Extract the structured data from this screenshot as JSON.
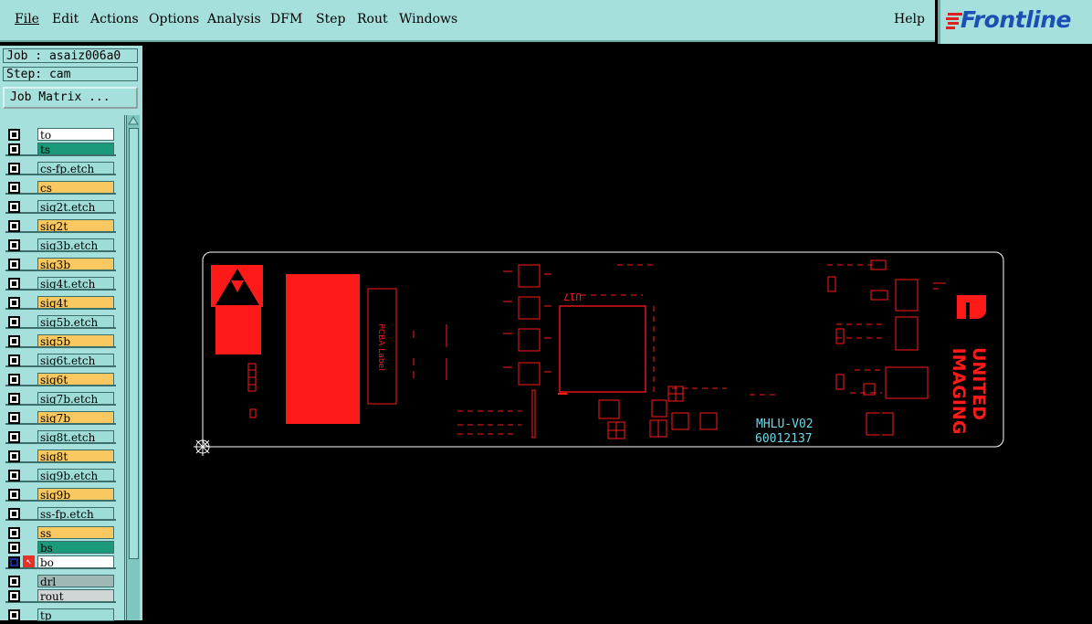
{
  "menu": {
    "items": [
      "File",
      "Edit",
      "Actions",
      "Options",
      "Analysis",
      "DFM",
      "Step",
      "Rout",
      "Windows"
    ],
    "help": "Help"
  },
  "logo": {
    "text": "Frontline",
    "icon": "frontline-logo-icon"
  },
  "sidebar": {
    "job": "Job : asaiz006a0",
    "step": "Step: cam",
    "job_matrix": "Job Matrix ..."
  },
  "layers": [
    {
      "name": "to",
      "color": "white"
    },
    {
      "name": "ts",
      "color": "green"
    },
    {
      "name": "cs-fp.etch",
      "color": "cyan"
    },
    {
      "name": "cs",
      "color": "orange"
    },
    {
      "name": "sig2t.etch",
      "color": "cyan"
    },
    {
      "name": "sig2t",
      "color": "orange"
    },
    {
      "name": "sig3b.etch",
      "color": "cyan"
    },
    {
      "name": "sig3b",
      "color": "orange"
    },
    {
      "name": "sig4t.etch",
      "color": "cyan"
    },
    {
      "name": "sig4t",
      "color": "orange"
    },
    {
      "name": "sig5b.etch",
      "color": "cyan"
    },
    {
      "name": "sig5b",
      "color": "orange"
    },
    {
      "name": "sig6t.etch",
      "color": "cyan"
    },
    {
      "name": "sig6t",
      "color": "orange"
    },
    {
      "name": "sig7b.etch",
      "color": "cyan"
    },
    {
      "name": "sig7b",
      "color": "orange"
    },
    {
      "name": "sig8t.etch",
      "color": "cyan"
    },
    {
      "name": "sig8t",
      "color": "orange"
    },
    {
      "name": "sig9b.etch",
      "color": "cyan"
    },
    {
      "name": "sig9b",
      "color": "orange"
    },
    {
      "name": "ss-fp.etch",
      "color": "cyan"
    },
    {
      "name": "ss",
      "color": "orange"
    },
    {
      "name": "bs",
      "color": "green"
    },
    {
      "name": "bo",
      "color": "white",
      "active": true
    },
    {
      "name": "drl",
      "color": "gray"
    },
    {
      "name": "rout",
      "color": "lgray"
    },
    {
      "name": "tp",
      "color": "cyan"
    }
  ],
  "board": {
    "label_text": "PCBA Label",
    "ref_u17": "U17",
    "part_name": "MHLU-V02",
    "part_number": "60012137",
    "brand_line1": "UNITED",
    "brand_line2": "IMAGING"
  },
  "colors": {
    "panel": "#a6e0dc",
    "silkscreen": "#ff1a1a",
    "outline": "#ffffff",
    "cyan_text": "#6fd8e8",
    "logo_blue": "#1c4fb3"
  }
}
